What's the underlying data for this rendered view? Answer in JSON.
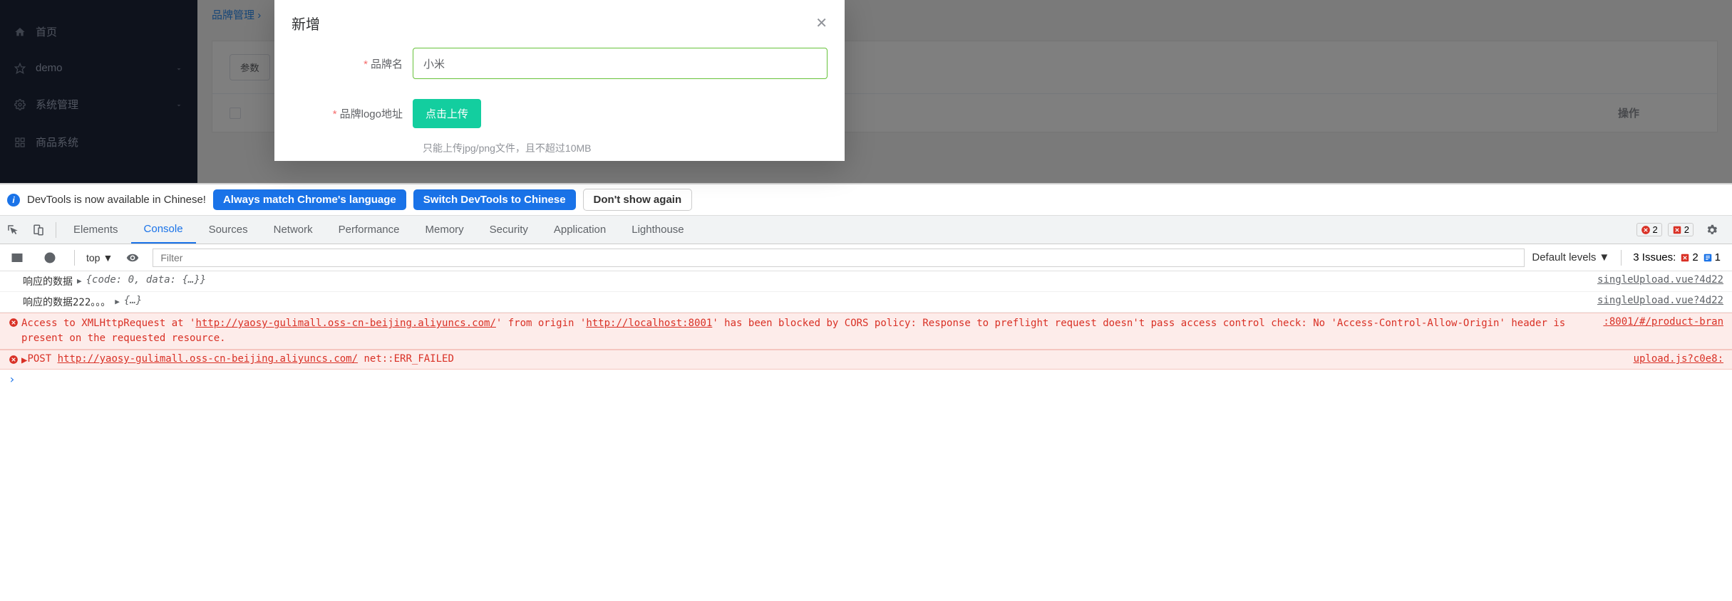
{
  "sidebar": {
    "items": [
      {
        "label": "首页",
        "icon": "home"
      },
      {
        "label": "demo",
        "icon": "star",
        "hasChildren": true
      },
      {
        "label": "系统管理",
        "icon": "gear",
        "hasChildren": true
      },
      {
        "label": "商品系统",
        "icon": "grid",
        "hasChildren": true
      }
    ]
  },
  "breadcrumb": {
    "text": "品牌管理",
    "sep": "›"
  },
  "content": {
    "paramsLabel": "参数",
    "opHeader": "操作"
  },
  "dialog": {
    "title": "新增",
    "form": {
      "nameLabel": "品牌名",
      "nameValue": "小米",
      "logoLabel": "品牌logo地址",
      "uploadBtn": "点击上传",
      "hint": "只能上传jpg/png文件，且不超过10MB"
    }
  },
  "devtools": {
    "infoBar": {
      "text": "DevTools is now available in Chinese!",
      "btn1": "Always match Chrome's language",
      "btn2": "Switch DevTools to Chinese",
      "btn3": "Don't show again"
    },
    "tabs": [
      "Elements",
      "Console",
      "Sources",
      "Network",
      "Performance",
      "Memory",
      "Security",
      "Application",
      "Lighthouse"
    ],
    "activeTab": "Console",
    "errorCount": "2",
    "violationCount": "2",
    "toolbar": {
      "context": "top",
      "filterPlaceholder": "Filter",
      "levels": "Default levels",
      "issuesLabel": "3 Issues:",
      "issueErr": "2",
      "issueInfo": "1"
    },
    "console": {
      "line1": {
        "label": "响应的数据",
        "obj": "{code: 0, data: {…}}",
        "src": "singleUpload.vue?4d22"
      },
      "line2": {
        "label": "响应的数据222。。。",
        "obj": "{…}",
        "src": "singleUpload.vue?4d22"
      },
      "err1": {
        "pre": "Access to XMLHttpRequest at '",
        "url1": "http://yaosy-gulimall.oss-cn-beijing.aliyuncs.com/",
        "mid1": "' from origin '",
        "url2": "http://localhost:8001",
        "post": "' has been blocked by CORS policy: Response to preflight request doesn't pass access control check: No 'Access-Control-Allow-Origin' header is present on the requested resource.",
        "src": ":8001/#/product-bran"
      },
      "err2": {
        "method": "POST",
        "url": "http://yaosy-gulimall.oss-cn-beijing.aliyuncs.com/",
        "status": "net::ERR_FAILED",
        "src": "upload.js?c0e8:"
      }
    }
  }
}
